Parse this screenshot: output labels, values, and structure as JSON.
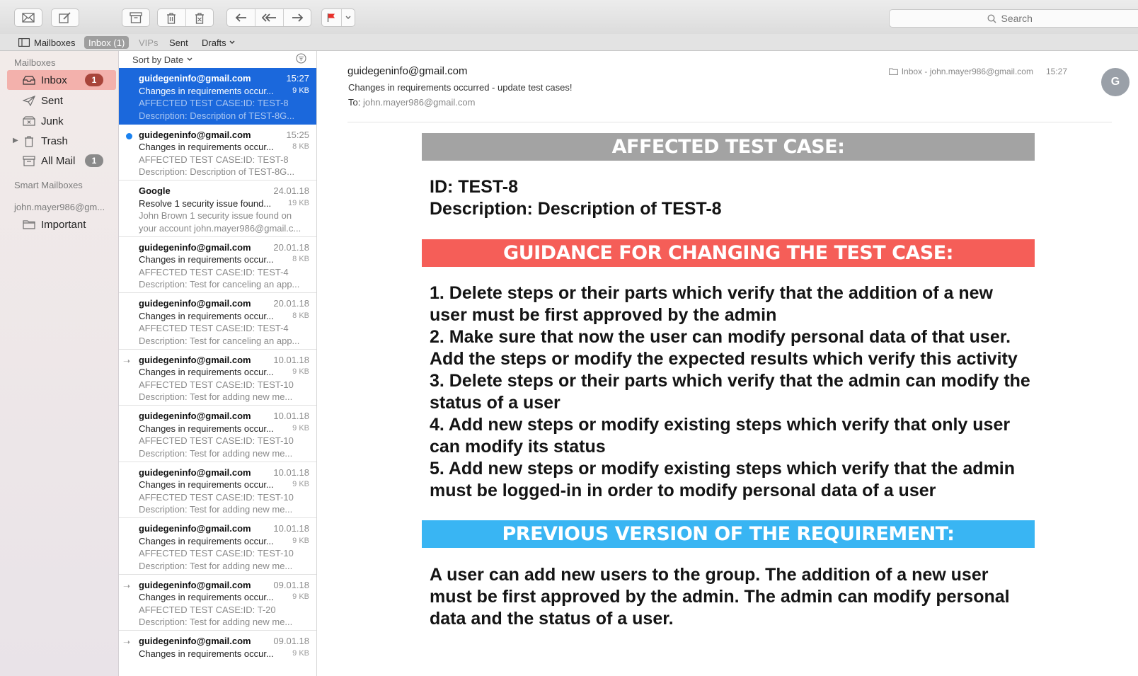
{
  "toolbar": {
    "search_placeholder": "Search",
    "icons": [
      "envelope-icon",
      "compose-icon",
      "archive-icon",
      "trash-icon",
      "junk-icon",
      "reply-icon",
      "reply-all-icon",
      "forward-icon",
      "flag-icon",
      "chevron-down-icon",
      "search-icon"
    ],
    "flag_color": "#e8302a"
  },
  "favbar": {
    "mailboxes": "Mailboxes",
    "inbox": "Inbox (1)",
    "vips": "VIPs",
    "sent": "Sent",
    "drafts": "Drafts"
  },
  "sidebar": {
    "section_mailboxes": "Mailboxes",
    "items": [
      {
        "label": "Inbox",
        "badge": "1"
      },
      {
        "label": "Sent"
      },
      {
        "label": "Junk"
      },
      {
        "label": "Trash"
      },
      {
        "label": "All Mail",
        "badge": "1"
      }
    ],
    "section_smart": "Smart Mailboxes",
    "account": "john.mayer986@gm...",
    "important": "Important"
  },
  "list": {
    "sort_label": "Sort by Date",
    "messages": [
      {
        "from": "guidegeninfo@gmail.com",
        "time": "15:27",
        "subject": "Changes in requirements occur...",
        "size": "9 KB",
        "line1": "AFFECTED TEST CASE:ID: TEST-8",
        "line2": "Description: Description of TEST-8G...",
        "selected": true
      },
      {
        "from": "guidegeninfo@gmail.com",
        "time": "15:25",
        "subject": "Changes in requirements occur...",
        "size": "8 KB",
        "line1": "AFFECTED TEST CASE:ID: TEST-8",
        "line2": "Description: Description of TEST-8G...",
        "unread": true
      },
      {
        "from": "Google",
        "time": "24.01.18",
        "subject": "Resolve 1 security issue found...",
        "size": "19 KB",
        "line1": "John Brown 1 security issue found on",
        "line2": "your account john.mayer986@gmail.c..."
      },
      {
        "from": "guidegeninfo@gmail.com",
        "time": "20.01.18",
        "subject": "Changes in requirements occur...",
        "size": "8 KB",
        "line1": "AFFECTED TEST CASE:ID: TEST-4",
        "line2": "Description: Test for canceling an app..."
      },
      {
        "from": "guidegeninfo@gmail.com",
        "time": "20.01.18",
        "subject": "Changes in requirements occur...",
        "size": "8 KB",
        "line1": "AFFECTED TEST CASE:ID: TEST-4",
        "line2": "Description: Test for canceling an app..."
      },
      {
        "from": "guidegeninfo@gmail.com",
        "time": "10.01.18",
        "subject": "Changes in requirements occur...",
        "size": "9 KB",
        "line1": "AFFECTED TEST CASE:ID: TEST-10",
        "line2": "Description: Test for adding new me...",
        "forwarded": true
      },
      {
        "from": "guidegeninfo@gmail.com",
        "time": "10.01.18",
        "subject": "Changes in requirements occur...",
        "size": "9 KB",
        "line1": "AFFECTED TEST CASE:ID: TEST-10",
        "line2": "Description: Test for adding new me..."
      },
      {
        "from": "guidegeninfo@gmail.com",
        "time": "10.01.18",
        "subject": "Changes in requirements occur...",
        "size": "9 KB",
        "line1": "AFFECTED TEST CASE:ID: TEST-10",
        "line2": "Description: Test for adding new me..."
      },
      {
        "from": "guidegeninfo@gmail.com",
        "time": "10.01.18",
        "subject": "Changes in requirements occur...",
        "size": "9 KB",
        "line1": "AFFECTED TEST CASE:ID: TEST-10",
        "line2": "Description: Test for adding new me..."
      },
      {
        "from": "guidegeninfo@gmail.com",
        "time": "09.01.18",
        "subject": "Changes in requirements occur...",
        "size": "9 KB",
        "line1": "AFFECTED TEST CASE:ID: T-20",
        "line2": "Description: Test for adding new me...",
        "forwarded": true
      },
      {
        "from": "guidegeninfo@gmail.com",
        "time": "09.01.18",
        "subject": "Changes in requirements occur...",
        "size": "9 KB",
        "line1": "",
        "line2": "",
        "forwarded": true
      }
    ]
  },
  "message": {
    "from": "guidegeninfo@gmail.com",
    "subject": "Changes in requirements occurred - update test cases!",
    "to_label": "To:",
    "to": "john.mayer986@gmail.com",
    "mailbox": "Inbox - john.mayer986@gmail.com",
    "time": "15:27",
    "avatar_initial": "G",
    "banner1": "AFFECTED TEST CASE:",
    "id_line": "ID: TEST-8",
    "desc_line": "Description: Description of TEST-8",
    "banner2": "GUIDANCE FOR CHANGING THE TEST CASE:",
    "guidance": [
      "1. Delete steps or their parts which verify that the addition of a new user must be first approved by the admin",
      "2. Make sure that now the user can modify personal data of that user. Add the steps or modify the expected results which verify this activity",
      "3. Delete steps or their parts which verify that the admin can modify the status of a user",
      "4. Add new steps or modify existing steps which verify that only user can modify its status",
      "5. Add new steps or modify existing steps which verify that the admin must be logged-in in order to modify personal data of a user"
    ],
    "banner3": "PREVIOUS VERSION OF THE REQUIREMENT:",
    "previous": "A user can add new users to the group. The addition of a new user must be first approved by the admin. The admin can modify personal data and the status of a user.",
    "colors": {
      "gray": "#a3a3a3",
      "red": "#f55e58",
      "blue": "#39b5f3",
      "selection": "#1b68dc"
    }
  }
}
